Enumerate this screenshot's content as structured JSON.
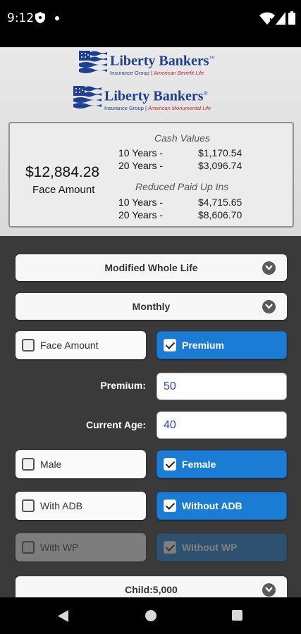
{
  "status_bar": {
    "time": "9:12"
  },
  "header": {
    "logo1": {
      "name": "Liberty Bankers",
      "mark": "™",
      "sub_left": "Insurance Group",
      "sub_right": "American Benefit Life"
    },
    "logo2": {
      "name": "Liberty Bankers",
      "mark": "®",
      "sub_left": "Insurance Group",
      "sub_right": "American Monumental Life"
    }
  },
  "summary": {
    "face_amount_value": "$12,884.28",
    "face_amount_label": "Face Amount",
    "cash_values_title": "Cash Values",
    "cash_values": [
      {
        "label": "10 Years -",
        "value": "$1,170.54"
      },
      {
        "label": "20 Years -",
        "value": "$3,096.74"
      }
    ],
    "reduced_paid_up_title": "Reduced Paid Up Ins",
    "reduced_paid_up": [
      {
        "label": "10 Years -",
        "value": "$4,715.65"
      },
      {
        "label": "20 Years -",
        "value": "$8,606.70"
      }
    ]
  },
  "form": {
    "plan_select": "Modified Whole Life",
    "mode_select": "Monthly",
    "calc_face_amount": "Face Amount",
    "calc_premium": "Premium",
    "premium_label": "Premium:",
    "premium_value": "50",
    "age_label": "Current Age:",
    "age_value": "40",
    "male": "Male",
    "female": "Female",
    "with_adb": "With ADB",
    "without_adb": "Without ADB",
    "with_wp": "With WP",
    "without_wp": "Without WP",
    "child_rider_select": "Child:5,000"
  }
}
